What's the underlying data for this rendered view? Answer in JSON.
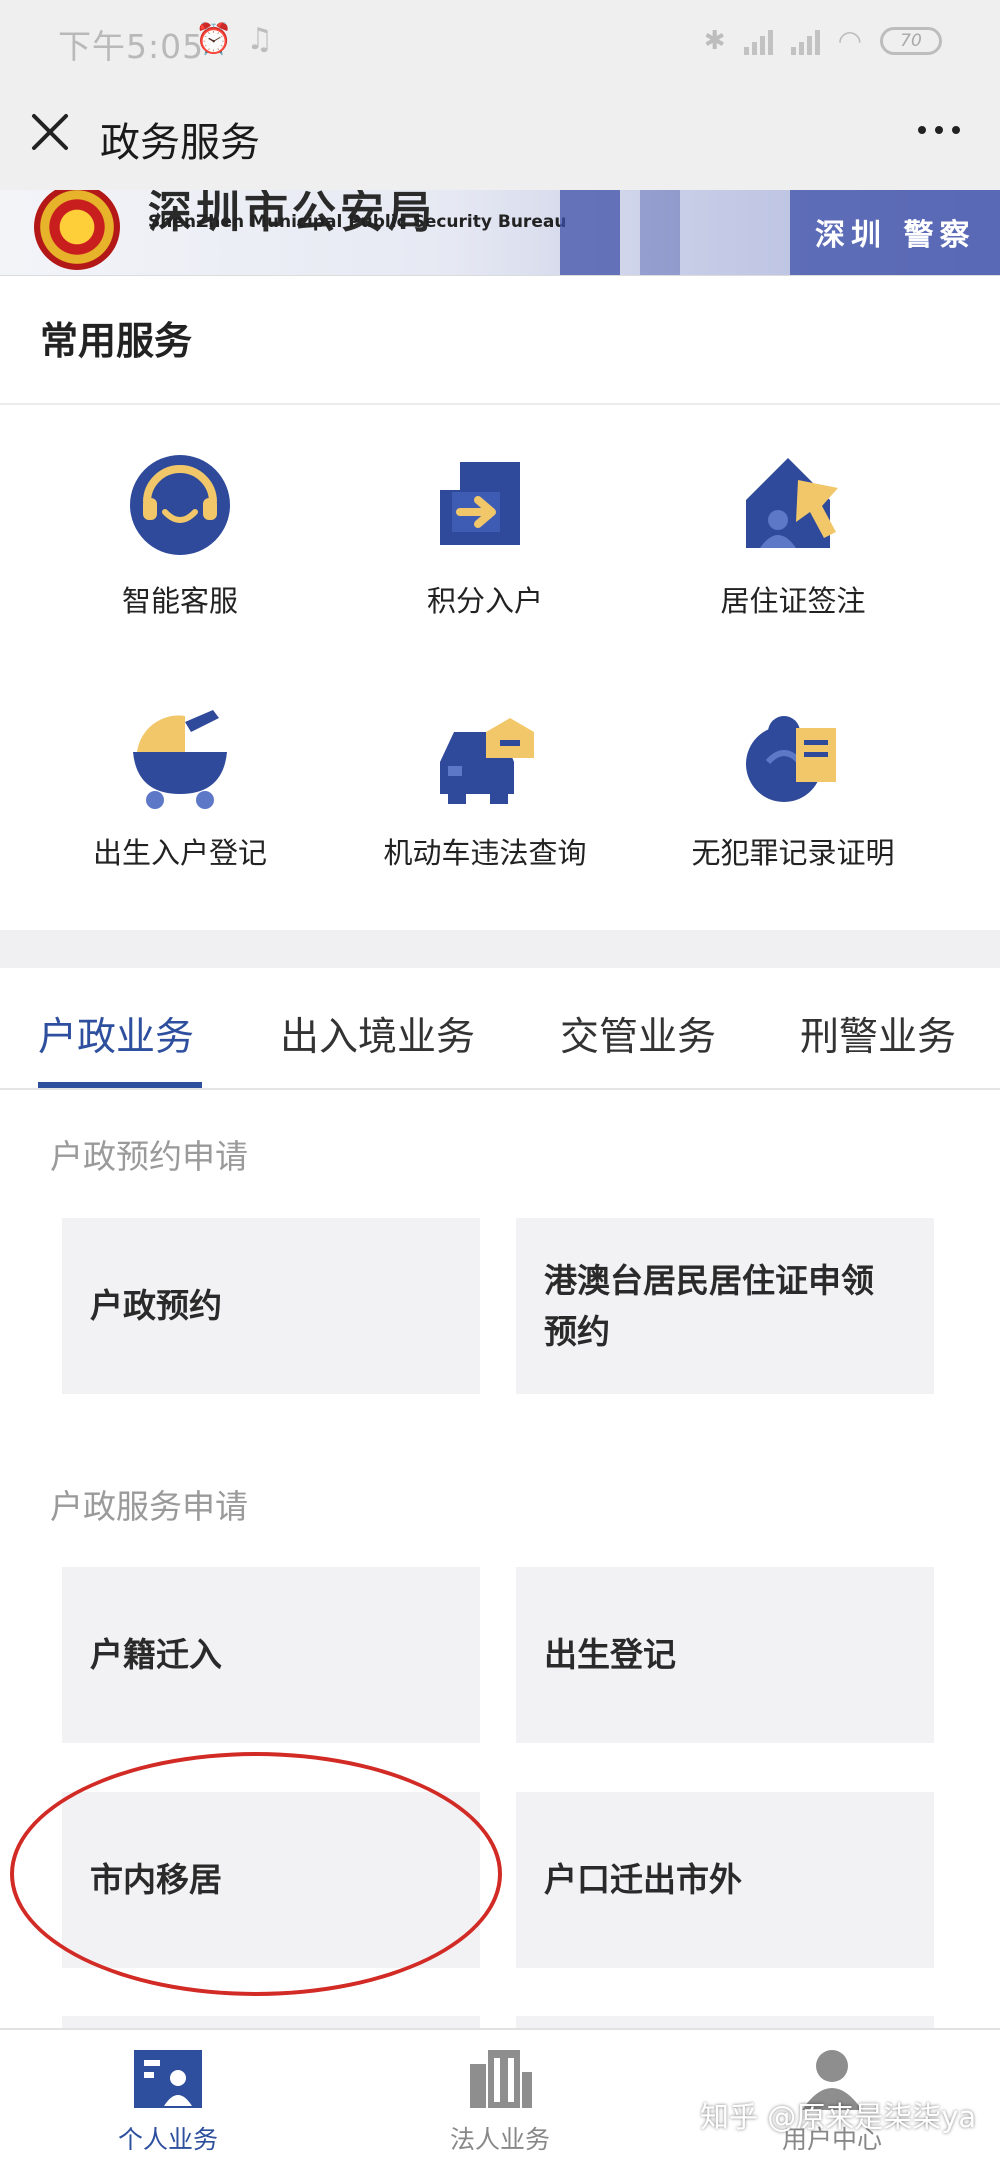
{
  "status_bar": {
    "time": "下午5:05",
    "battery": "70"
  },
  "titlebar": {
    "title": "政务服务"
  },
  "banner": {
    "bureau_cn": "深圳市公安局",
    "bureau_en": "ShenZhen Municipal Public Security Bureau",
    "sign_text": "深圳 警察"
  },
  "common_services": {
    "title": "常用服务",
    "items": [
      {
        "label": "智能客服",
        "icon": "customer-service-icon"
      },
      {
        "label": "积分入户",
        "icon": "points-settle-icon"
      },
      {
        "label": "居住证签注",
        "icon": "residence-permit-icon"
      },
      {
        "label": "出生入户登记",
        "icon": "birth-registration-icon"
      },
      {
        "label": "机动车违法查询",
        "icon": "vehicle-violation-icon"
      },
      {
        "label": "无犯罪记录证明",
        "icon": "no-crime-certificate-icon"
      }
    ]
  },
  "tabs": [
    {
      "label": "户政业务",
      "active": true
    },
    {
      "label": "出入境业务"
    },
    {
      "label": "交管业务"
    },
    {
      "label": "刑警业务"
    }
  ],
  "sections": [
    {
      "title": "户政预约申请",
      "cards": [
        "户政预约",
        "港澳台居民居住证申领预约"
      ]
    },
    {
      "title": "户政服务申请",
      "cards": [
        "户籍迁入",
        "出生登记",
        "市内移居",
        "户口迁出市外"
      ]
    }
  ],
  "bottom_nav": [
    {
      "label": "个人业务",
      "active": true
    },
    {
      "label": "法人业务"
    },
    {
      "label": "用户中心"
    }
  ],
  "watermark": "知乎 @原来是柒柒ya",
  "colors": {
    "accent": "#2d4f9e",
    "icon_blue": "#2f4a9a",
    "icon_yellow": "#f2c769",
    "annotation": "#d22a25"
  }
}
